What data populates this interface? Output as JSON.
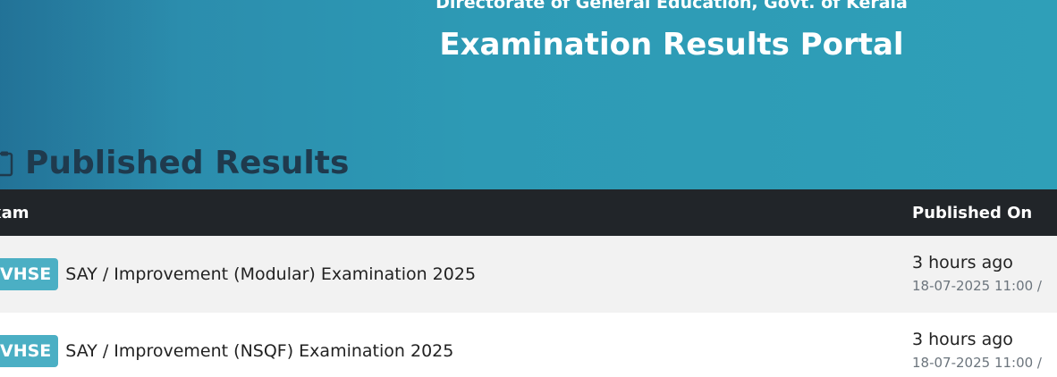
{
  "header": {
    "subtitle": "Directorate of General Education, Govt. of Kerala",
    "title": "Examination Results Portal"
  },
  "section": {
    "icon": "clipboard-icon",
    "title": "Published Results"
  },
  "table": {
    "columns": {
      "exam": "xam",
      "published_on": "Published On"
    },
    "rows": [
      {
        "badge": "VHSE",
        "exam": "SAY / Improvement (Modular) Examination 2025",
        "relative": "3 hours ago",
        "datetime": "18-07-2025 11:00 /"
      },
      {
        "badge": "VHSE",
        "exam": "SAY / Improvement (NSQF) Examination 2025",
        "relative": "3 hours ago",
        "datetime": "18-07-2025 11:00 /"
      }
    ]
  },
  "colors": {
    "banner": "#2d9ab5",
    "table_header": "#212529",
    "badge": "#4bafc4",
    "heading": "#1f3a4d"
  }
}
